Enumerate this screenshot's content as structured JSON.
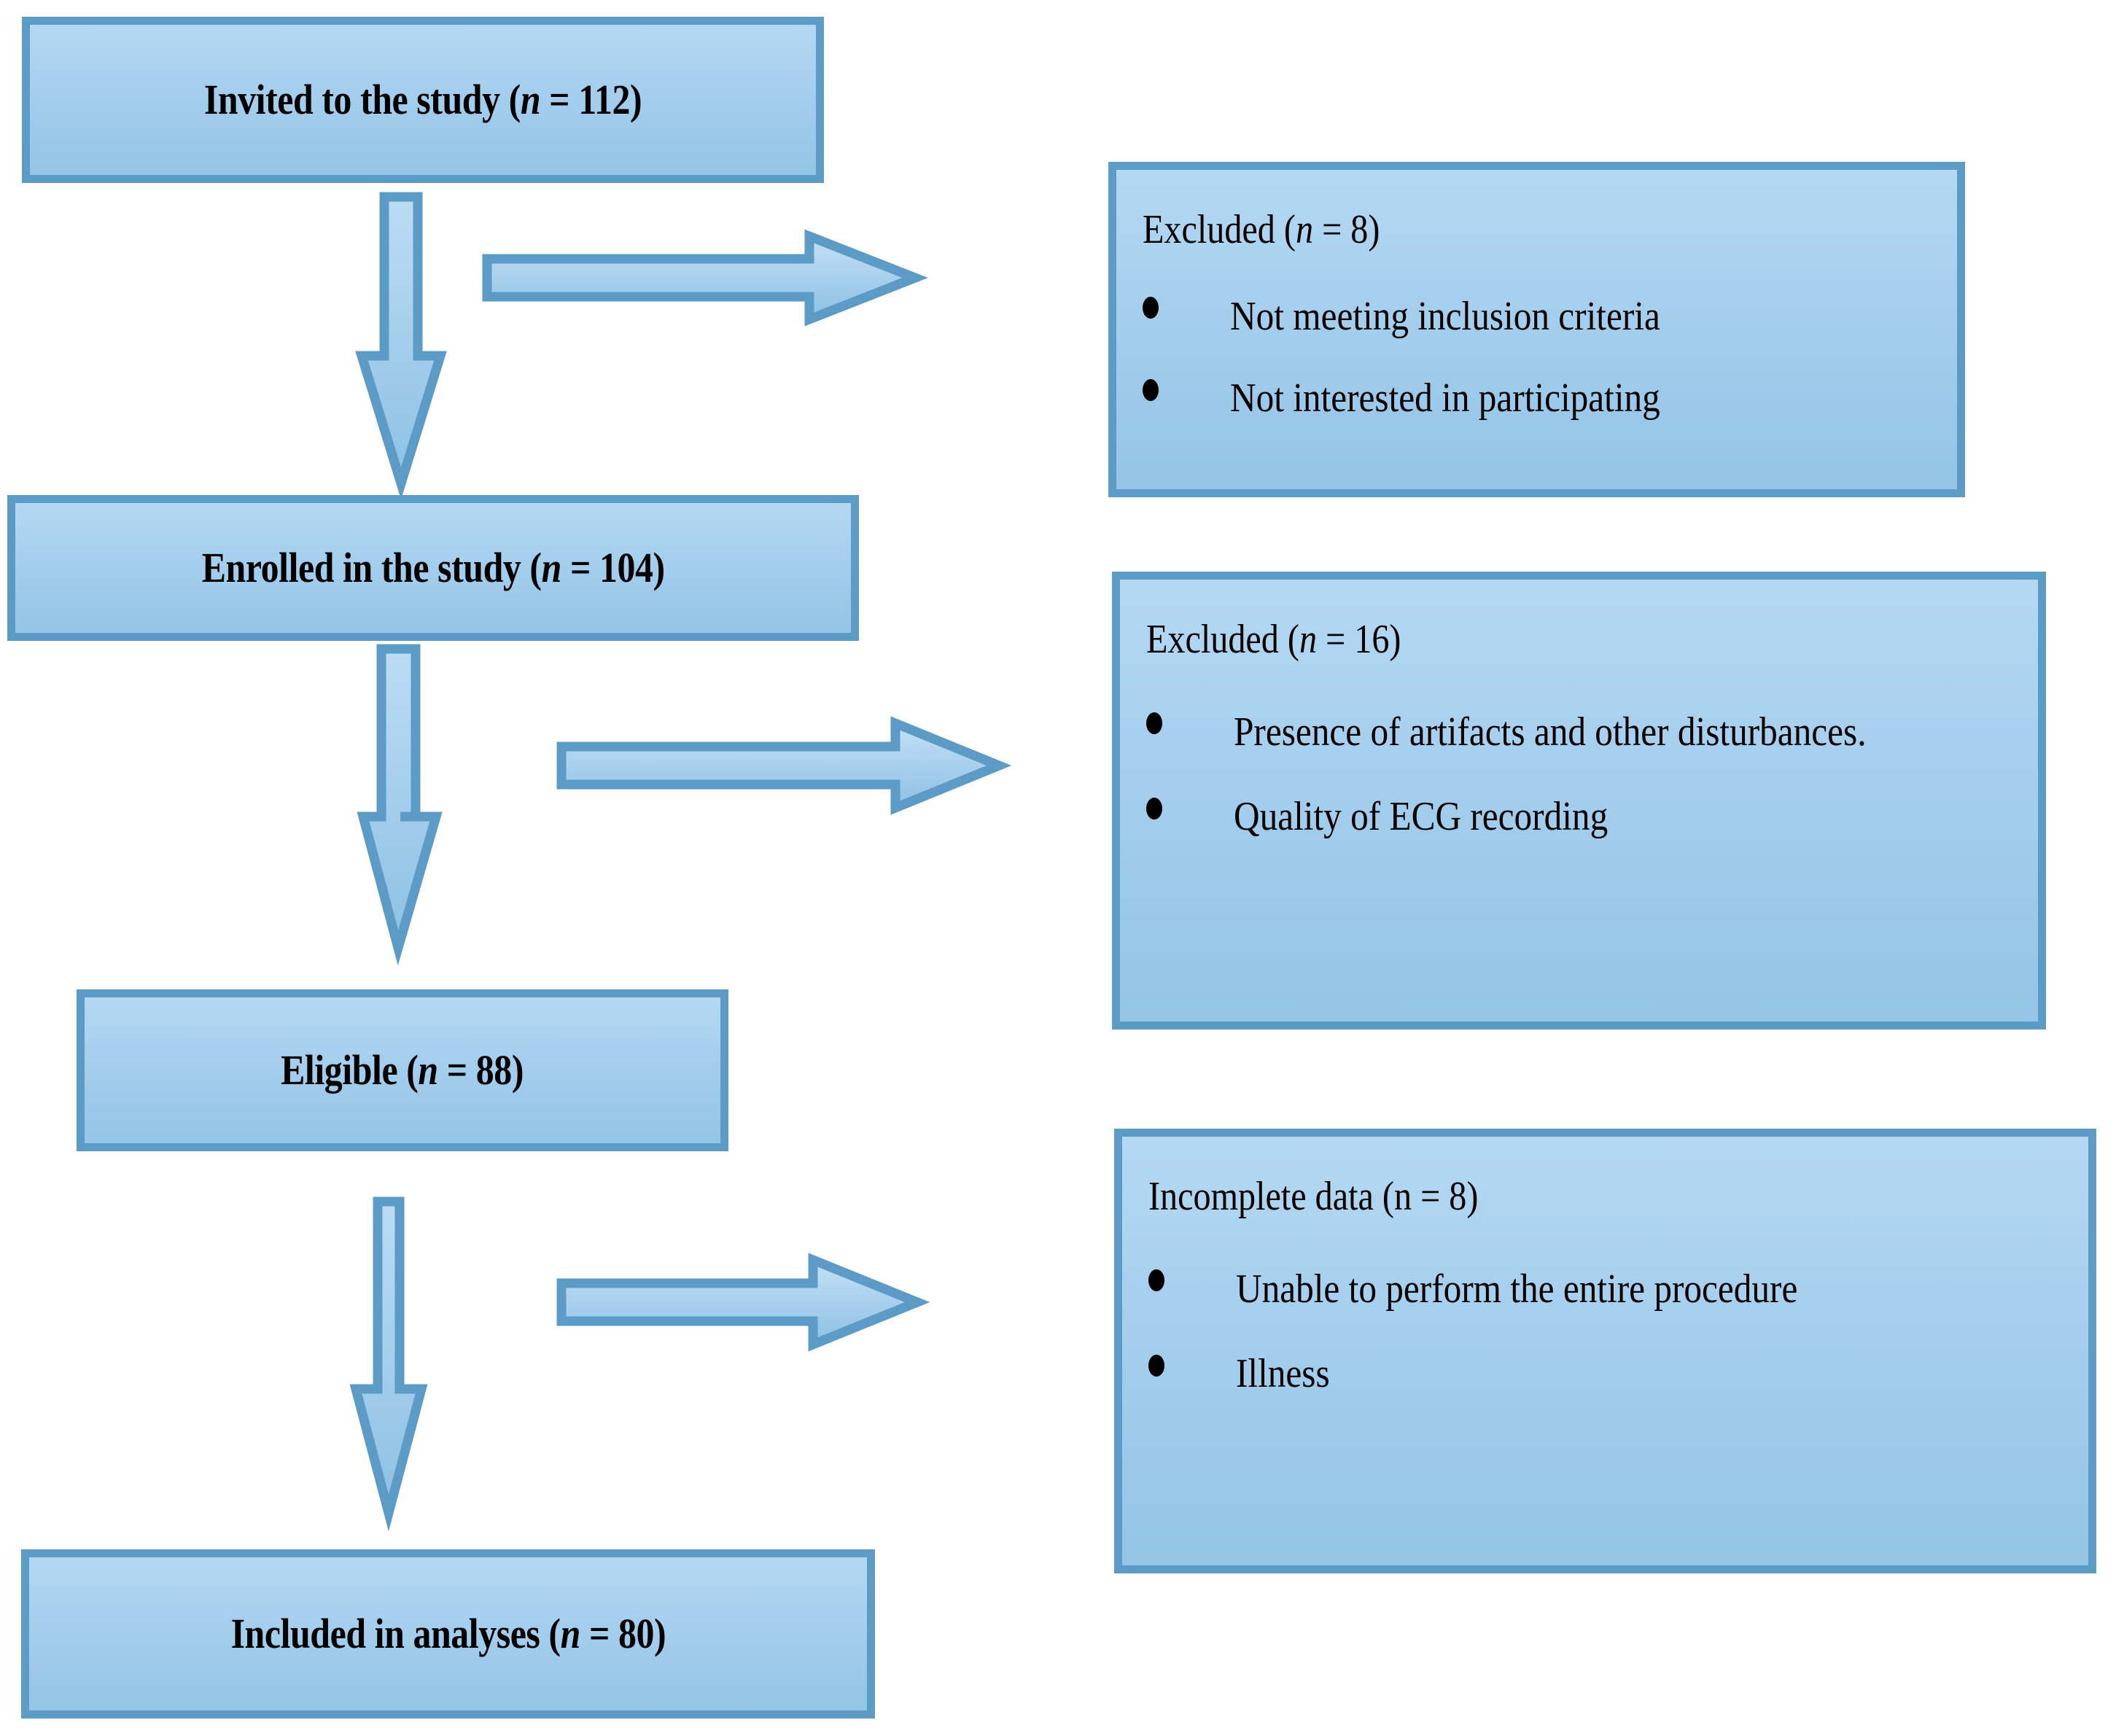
{
  "diagram": {
    "title": "Study participant flow diagram",
    "colors": {
      "box_border": "#5b9bc5",
      "box_fill_top": "#b4d8f2",
      "box_fill_bottom": "#94c4e6",
      "arrow_border": "#5b9bc5",
      "arrow_fill": "#a8d0ee",
      "text": "#000000",
      "background": "#ffffff"
    }
  },
  "flow": {
    "steps": [
      {
        "id": "invited",
        "label_prefix": "Invited to the study (",
        "label_italic": "n",
        "label_suffix": " = 112)"
      },
      {
        "id": "enrolled",
        "label_prefix": "Enrolled in the study (",
        "label_italic": "n",
        "label_suffix": " = 104)"
      },
      {
        "id": "eligible",
        "label_prefix": "Eligible (",
        "label_italic": "n",
        "label_suffix": " = 88)"
      },
      {
        "id": "included",
        "label_prefix": "Included in analyses (",
        "label_italic": "n",
        "label_suffix": " = 80)"
      }
    ]
  },
  "exclusions": [
    {
      "id": "excluded-8",
      "head_prefix": "Excluded (",
      "head_italic": "n",
      "head_suffix": " = 8)",
      "items": [
        "Not meeting inclusion criteria",
        "Not interested in participating"
      ]
    },
    {
      "id": "excluded-16",
      "head_prefix": "Excluded (",
      "head_italic": "n",
      "head_suffix": " = 16)",
      "items": [
        "Presence of artifacts and other disturbances.",
        "Quality of ECG recording"
      ]
    },
    {
      "id": "incomplete-8",
      "head_prefix": "Incomplete data (n = 8)",
      "head_italic": "",
      "head_suffix": "",
      "items": [
        "Unable to perform the entire procedure",
        "Illness"
      ]
    }
  ],
  "connectors": {
    "down_arrows": [
      {
        "id": "down-1",
        "from": "invited",
        "to": "enrolled"
      },
      {
        "id": "down-2",
        "from": "enrolled",
        "to": "eligible"
      },
      {
        "id": "down-3",
        "from": "eligible",
        "to": "included"
      }
    ],
    "right_arrows": [
      {
        "id": "right-1",
        "from": "invited",
        "to": "excluded-8"
      },
      {
        "id": "right-2",
        "from": "enrolled",
        "to": "excluded-16"
      },
      {
        "id": "right-3",
        "from": "eligible",
        "to": "incomplete-8"
      }
    ]
  },
  "chart_data": {
    "type": "diagram",
    "title": "Participant flow",
    "nodes": [
      {
        "name": "Invited to the study",
        "n": 112
      },
      {
        "name": "Enrolled in the study",
        "n": 104
      },
      {
        "name": "Eligible",
        "n": 88
      },
      {
        "name": "Included in analyses",
        "n": 80
      }
    ],
    "exclusions": [
      {
        "name": "Excluded",
        "n": 8,
        "reasons": [
          "Not meeting inclusion criteria",
          "Not interested in participating"
        ]
      },
      {
        "name": "Excluded",
        "n": 16,
        "reasons": [
          "Presence of artifacts and other disturbances.",
          "Quality of ECG recording"
        ]
      },
      {
        "name": "Incomplete data",
        "n": 8,
        "reasons": [
          "Unable to perform the entire procedure",
          "Illness"
        ]
      }
    ]
  }
}
